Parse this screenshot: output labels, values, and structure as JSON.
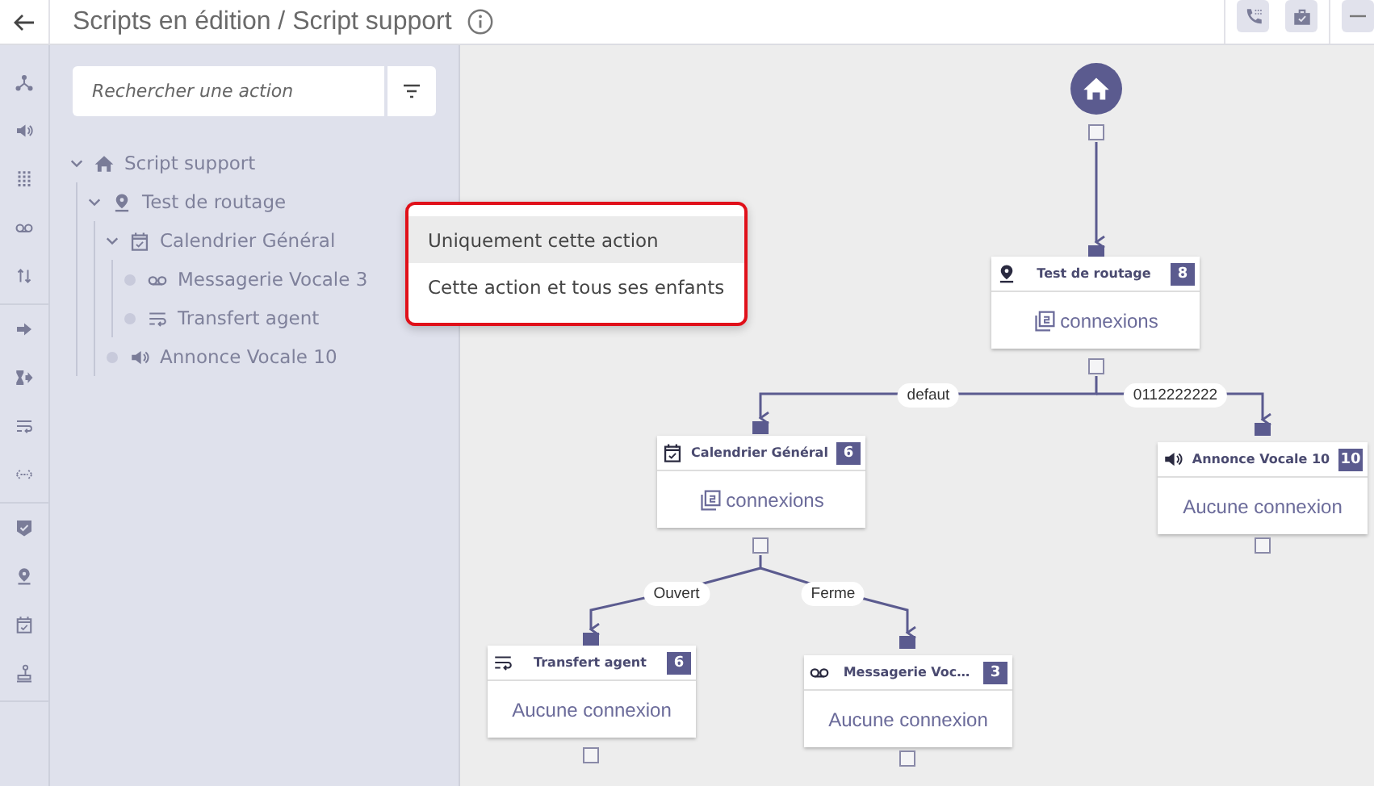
{
  "header": {
    "title": "Scripts en édition / Script support"
  },
  "sidebar": {
    "search": {
      "placeholder": "Rechercher une action"
    },
    "tree": [
      {
        "kind": "home",
        "label": "Script support",
        "expanded": true,
        "children": [
          {
            "kind": "pin",
            "label": "Test de routage",
            "expanded": true,
            "children": [
              {
                "kind": "calendar",
                "label": "Calendrier Général",
                "expanded": true,
                "children": [
                  {
                    "kind": "voicemail",
                    "label": "Messagerie Vocale 3",
                    "expanded": false
                  },
                  {
                    "kind": "transfer",
                    "label": "Transfert agent",
                    "expanded": false
                  }
                ]
              },
              {
                "kind": "speaker",
                "label": "Annonce Vocale 10",
                "expanded": false
              }
            ]
          }
        ]
      }
    ]
  },
  "context_menu": {
    "items": [
      {
        "label": "Uniquement cette action",
        "selected": true
      },
      {
        "label": "Cette action et tous ses enfants",
        "selected": false
      }
    ]
  },
  "canvas": {
    "nodes": [
      {
        "kind": "pin",
        "title": "Test de routage",
        "badge": "8",
        "body": "connexions",
        "connections": true
      },
      {
        "kind": "calendar",
        "title": "Calendrier Général",
        "badge": "6",
        "body": "connexions",
        "connections": true
      },
      {
        "kind": "speaker",
        "title": "Annonce Vocale 10",
        "badge": "10",
        "body": "Aucune connexion",
        "connections": false
      },
      {
        "kind": "transfer",
        "title": "Transfert agent",
        "badge": "6",
        "body": "Aucune connexion",
        "connections": false
      },
      {
        "kind": "voicemail",
        "title": "Messagerie Voc…",
        "badge": "3",
        "body": "Aucune connexion",
        "connections": false
      }
    ],
    "edges": [
      {
        "label": "defaut"
      },
      {
        "label": "0112222222"
      },
      {
        "label": "Ouvert"
      },
      {
        "label": "Ferme"
      }
    ]
  }
}
